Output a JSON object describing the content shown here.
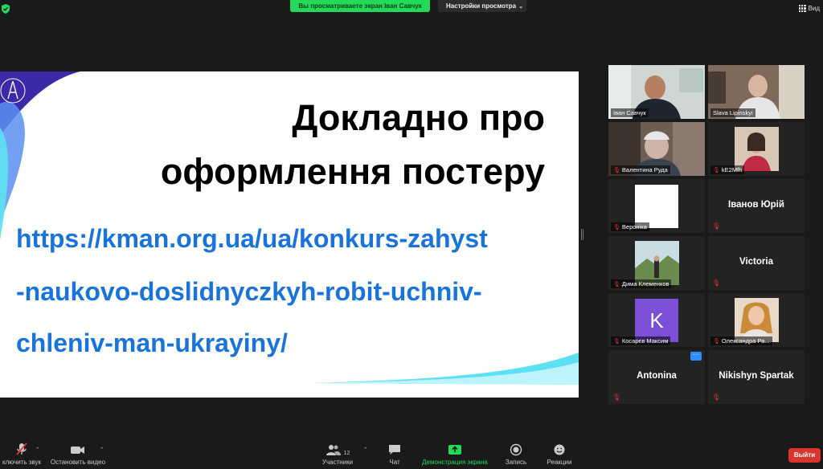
{
  "topbar": {
    "share_banner": "Вы просматриваете экран Іван Савчук",
    "view_options": "Настройки просмотра",
    "view_label": "Вид"
  },
  "slide": {
    "title_line1": "Докладно про",
    "title_line2": "оформлення постеру",
    "link_line1": "https://kman.org.ua/ua/konkurs-zahyst",
    "link_line2": "-naukovo-doslidnyczkyh-robit-uchniv-",
    "link_line3": "chleniv-man-ukrayiny/"
  },
  "participants": [
    {
      "name": "Іван Савчук"
    },
    {
      "name": "Slava Lipinskyi"
    },
    {
      "name": "Валентина Руда"
    },
    {
      "name": "kE2Mfh"
    },
    {
      "name": "Вероніка"
    },
    {
      "name": "Іванов Юрій"
    },
    {
      "name": "Дима Клеменков"
    },
    {
      "name": "Victoria"
    },
    {
      "name": "Косарєв Максим",
      "avatar_letter": "K"
    },
    {
      "name": "Олександра Ра..."
    },
    {
      "name": "Antonina"
    },
    {
      "name": "Nikishyn Spartak"
    }
  ],
  "toolbar": {
    "mute_label": "ключить звук",
    "video_label": "Остановить видео",
    "participants_label": "Участники",
    "participants_count": "12",
    "chat_label": "Чат",
    "share_label": "Демонстрация экрана",
    "record_label": "Запись",
    "reactions_label": "Реакции",
    "leave_label": "Выйти"
  },
  "colors": {
    "accent_green": "#23d959",
    "link_blue": "#1a73d9",
    "leave_red": "#d9352c",
    "active_speaker": "#c3e83c"
  }
}
